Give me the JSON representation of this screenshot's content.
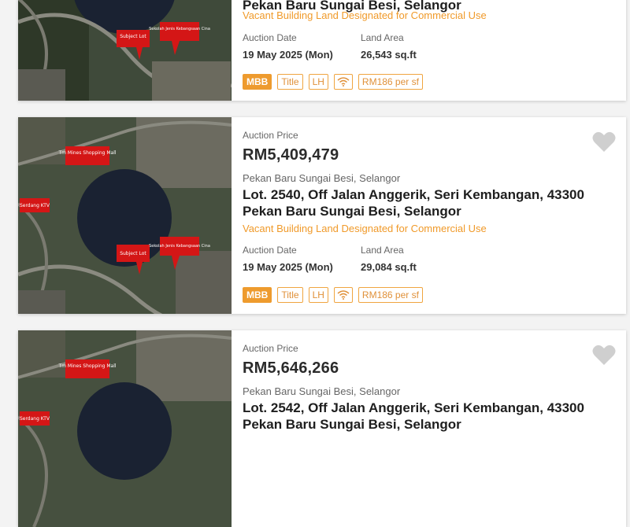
{
  "listings": [
    {
      "price_label": "",
      "price": "",
      "location": "",
      "title": "Pekan Baru Sungai Besi, Selangor",
      "category": "Vacant Building Land Designated for Commercial Use",
      "auction_date_label": "Auction Date",
      "auction_date": "19 May 2025 (Mon)",
      "land_area_label": "Land Area",
      "land_area": "26,543 sq.ft",
      "tags": {
        "bank": "MBB",
        "title": "Title",
        "tenure": "LH",
        "rate": "RM186 per sf"
      },
      "map_labels": {
        "subject": "Subject Lot",
        "school": "Sekolah Jenis Kebangsaan Cina"
      }
    },
    {
      "price_label": "Auction Price",
      "price": "RM5,409,479",
      "location": "Pekan Baru Sungai Besi, Selangor",
      "title": "Lot. 2540, Off Jalan Anggerik, Seri Kembangan, 43300 Pekan Baru Sungai Besi, Selangor",
      "category": "Vacant Building Land Designated for Commercial Use",
      "auction_date_label": "Auction Date",
      "auction_date": "19 May 2025 (Mon)",
      "land_area_label": "Land Area",
      "land_area": "29,084 sq.ft",
      "tags": {
        "bank": "MBB",
        "title": "Title",
        "tenure": "LH",
        "rate": "RM186 per sf"
      },
      "map_labels": {
        "mall": "Tm Mines Shopping Mall",
        "ktv": "Serdang KTV",
        "subject": "Subject Lot",
        "school": "Sekolah Jenis Kebangsaan Cina"
      }
    },
    {
      "price_label": "Auction Price",
      "price": "RM5,646,266",
      "location": "Pekan Baru Sungai Besi, Selangor",
      "title": "Lot. 2542, Off Jalan Anggerik, Seri Kembangan, 43300 Pekan Baru Sungai Besi, Selangor",
      "category": "",
      "auction_date_label": "",
      "auction_date": "",
      "land_area_label": "",
      "land_area": "",
      "tags": {},
      "map_labels": {
        "mall": "Tm Mines Shopping Mall",
        "ktv": "Serdang KTV"
      }
    }
  ],
  "colors": {
    "accent": "#ee9b2e",
    "category": "#f09a2a",
    "heart": "#cfcfcf"
  },
  "icons": {
    "favorite": "heart-icon",
    "connectivity": "wifi-icon"
  }
}
